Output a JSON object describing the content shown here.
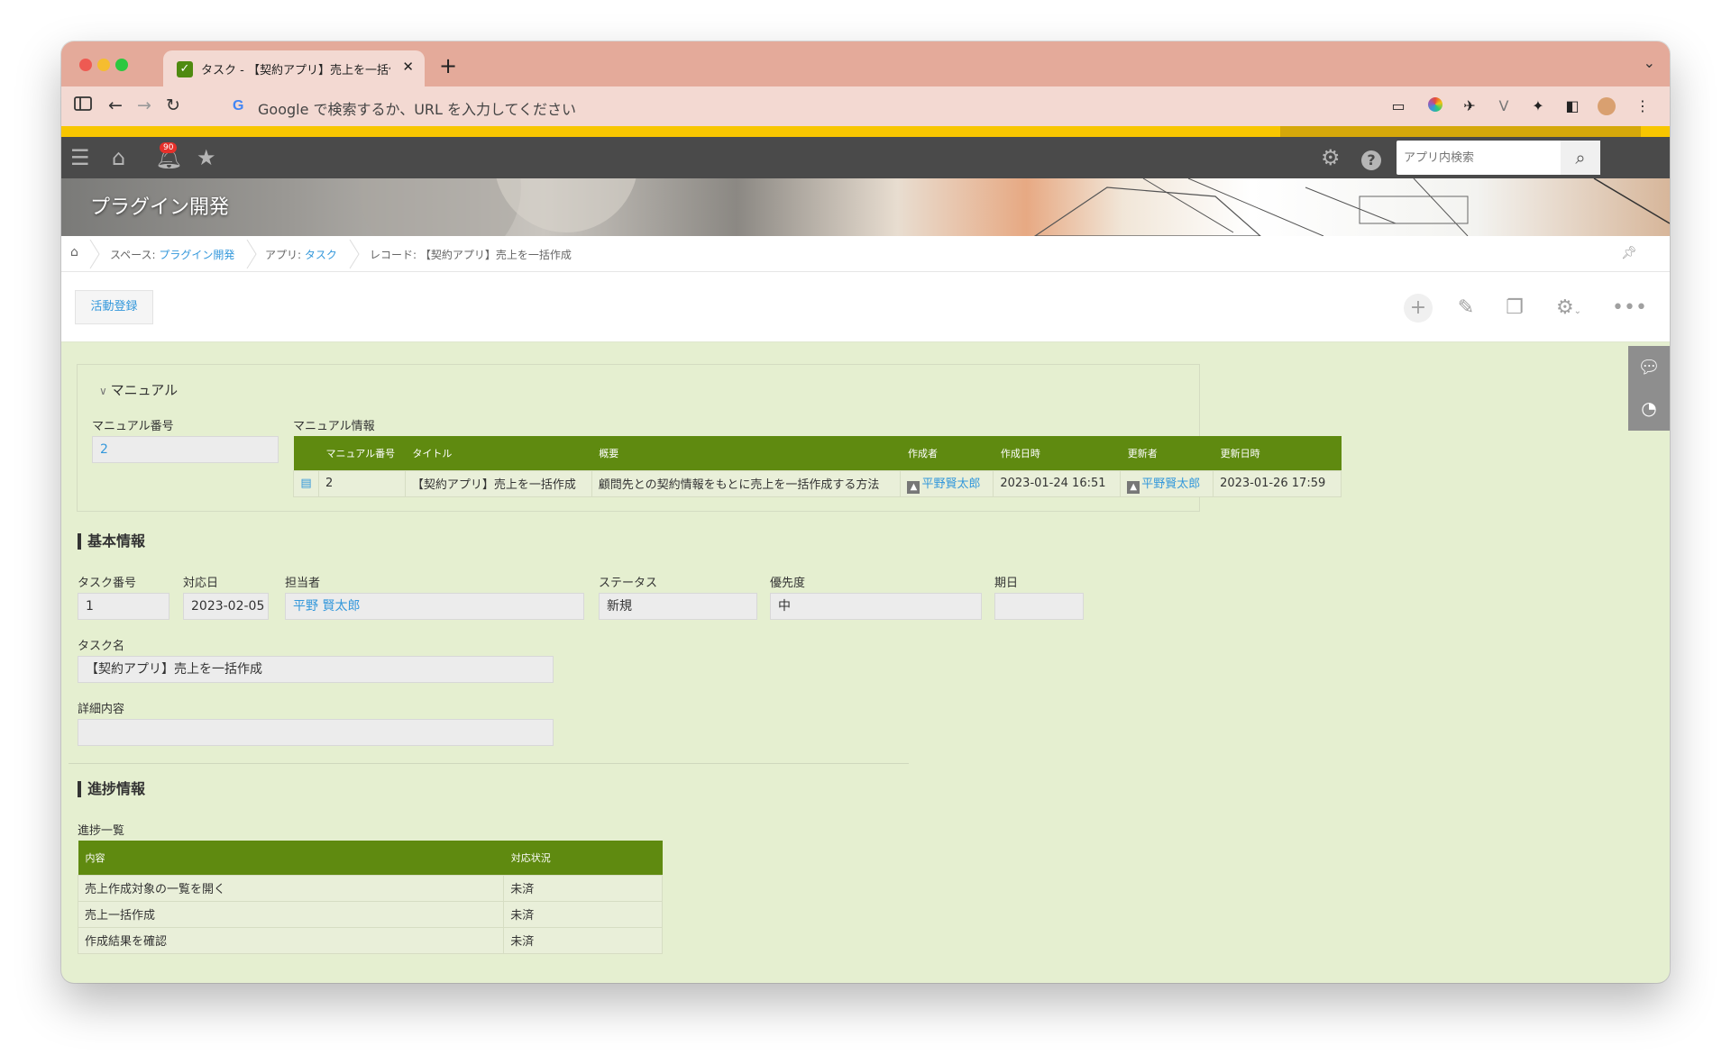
{
  "browser": {
    "tab_title": "タスク - 【契約アプリ】売上を一括作成",
    "omnibox_g": "G",
    "omnibox_text": "Google で検索するか、URL を入力してください"
  },
  "header": {
    "notification_count": "90",
    "search_placeholder": "アプリ内検索"
  },
  "banner": {
    "title": "プラグイン開発"
  },
  "breadcrumb": {
    "space_prefix": "スペース: ",
    "space_name": "プラグイン開発",
    "app_prefix": "アプリ: ",
    "app_name": "タスク",
    "record": "レコード: 【契約アプリ】売上を一括作成"
  },
  "actions": {
    "activity_button": "活動登録"
  },
  "manual_group": {
    "title": "マニュアル",
    "manual_no_label": "マニュアル番号",
    "manual_no_value": "2",
    "manual_info_label": "マニュアル情報",
    "columns": [
      "マニュアル番号",
      "タイトル",
      "概要",
      "作成者",
      "作成日時",
      "更新者",
      "更新日時"
    ],
    "rows": [
      {
        "no": "2",
        "title": "【契約アプリ】売上を一括作成",
        "summary": "顧問先との契約情報をもとに売上を一括作成する方法",
        "creator": "平野賢太郎",
        "created": "2023-01-24 16:51",
        "updater": "平野賢太郎",
        "updated": "2023-01-26 17:59"
      }
    ]
  },
  "basic": {
    "section_title": "基本情報",
    "task_no_label": "タスク番号",
    "task_no": "1",
    "date_label": "対応日",
    "date": "2023-02-05",
    "assignee_label": "担当者",
    "assignee": "平野 賢太郎",
    "status_label": "ステータス",
    "status": "新規",
    "priority_label": "優先度",
    "priority": "中",
    "due_label": "期日",
    "due": "",
    "task_name_label": "タスク名",
    "task_name": "【契約アプリ】売上を一括作成",
    "detail_label": "詳細内容",
    "detail": ""
  },
  "progress": {
    "section_title": "進捗情報",
    "list_label": "進捗一覧",
    "columns": [
      "内容",
      "対応状況"
    ],
    "rows": [
      {
        "content": "売上作成対象の一覧を開く",
        "state": "未済"
      },
      {
        "content": "売上一括作成",
        "state": "未済"
      },
      {
        "content": "作成結果を確認",
        "state": "未済"
      }
    ]
  },
  "colors": {
    "accent_green": "#5f8a10",
    "background": "#e5efd0",
    "header": "#4a4a4a",
    "link": "#3498db",
    "yellow_bar": "#f8c600"
  }
}
